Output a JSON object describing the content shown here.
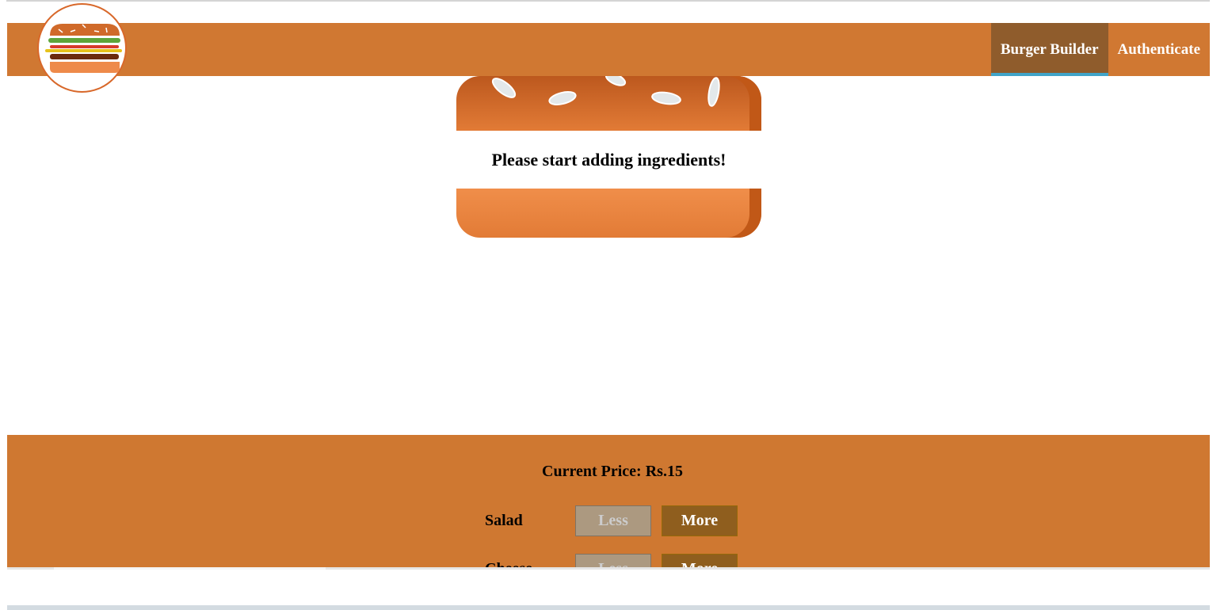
{
  "toolbar": {
    "logo_icon": "burger-logo-icon",
    "nav": [
      {
        "label": "Burger Builder",
        "active": true
      },
      {
        "label": "Authenticate",
        "active": false
      }
    ]
  },
  "burger": {
    "message": "Please start adding ingredients!"
  },
  "controls": {
    "price_text": "Current Price: Rs.15",
    "ingredients": [
      {
        "label": "Salad",
        "less": "Less",
        "more": "More"
      },
      {
        "label": "Cheese",
        "less": "Less",
        "more": "More"
      }
    ]
  },
  "colors": {
    "toolbar": "#d07832",
    "active_nav": "#8f5c2c",
    "active_underline": "#40a4c8",
    "less_button": "#ac9980",
    "more_button": "#8f5e1e"
  }
}
